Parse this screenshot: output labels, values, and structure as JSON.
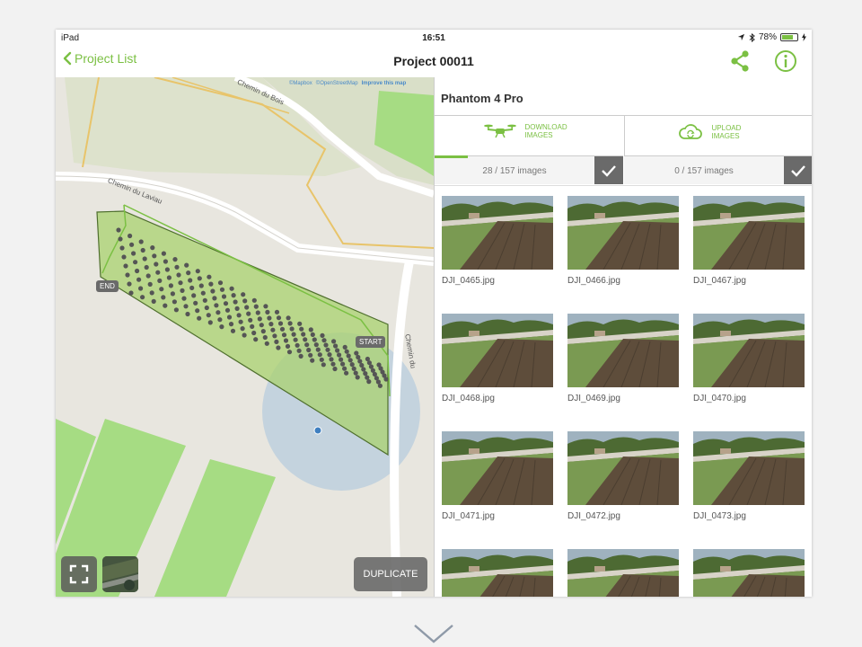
{
  "status_bar": {
    "device": "iPad",
    "time": "16:51",
    "battery": "78%",
    "battery_level": 0.78
  },
  "nav": {
    "back_label": "Project List",
    "title": "Project 00011"
  },
  "map": {
    "attribution": [
      "©Mapbox",
      "©OpenStreetMap",
      "Improve this map"
    ],
    "street_labels": [
      "Chemin du Bois",
      "Chemin du Laviau",
      "Chemin du"
    ],
    "marker_start": "START",
    "marker_end": "END",
    "duplicate_label": "DUPLICATE"
  },
  "panel": {
    "drone": "Phantom 4 Pro",
    "download": {
      "label": "DOWNLOAD IMAGES",
      "count_text": "28 / 157 images",
      "done": 28,
      "total": 157
    },
    "upload": {
      "label": "UPLOAD IMAGES",
      "count_text": "0 / 157 images",
      "done": 0,
      "total": 157
    },
    "images": [
      "DJI_0465.jpg",
      "DJI_0466.jpg",
      "DJI_0467.jpg",
      "DJI_0468.jpg",
      "DJI_0469.jpg",
      "DJI_0470.jpg",
      "DJI_0471.jpg",
      "DJI_0472.jpg",
      "DJI_0473.jpg",
      "",
      "",
      ""
    ]
  },
  "colors": {
    "accent": "#7bc043",
    "dark_button": "#6a6a6a",
    "field_green": "#a6dc83",
    "coverage": "#b8dd8a"
  }
}
